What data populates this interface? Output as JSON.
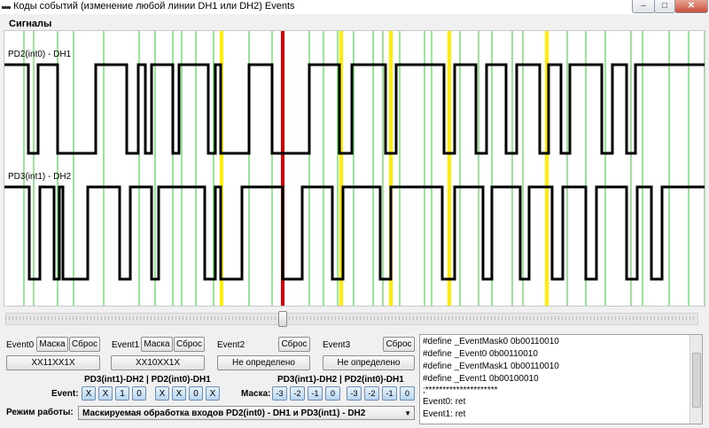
{
  "window": {
    "title": "Коды событий (изменение любой линии DH1 или DH2) Events"
  },
  "signals_panel": {
    "title": "Сигналы"
  },
  "signals": [
    {
      "label": "PD2(int0) - DH1"
    },
    {
      "label": "PD3(int1) - DH2"
    }
  ],
  "events": [
    {
      "label": "Event0",
      "mask_label": "Маска",
      "reset_label": "Сброс",
      "value": "XX11XX1X"
    },
    {
      "label": "Event1",
      "mask_label": "Маска",
      "reset_label": "Сброс",
      "value": "XX10XX1X"
    },
    {
      "label": "Event2",
      "reset_label": "Сброс",
      "value": "Не определено"
    },
    {
      "label": "Event3",
      "reset_label": "Сброс",
      "value": "Не определено"
    }
  ],
  "event_header": "PD3(int1)-DH2 | PD2(int0)-DH1",
  "event_label": "Event:",
  "event_bits": [
    "X",
    "X",
    "1",
    "0",
    "X",
    "X",
    "0",
    "X"
  ],
  "mask_header": "PD3(int1)-DH2 | PD2(int0)-DH1",
  "mask_label": "Маска:",
  "mask_bits": [
    "-3",
    "-2",
    "-1",
    "0",
    "-3",
    "-2",
    "-1",
    "0"
  ],
  "mode": {
    "label": "Режим работы:",
    "value": "Маскируемая обработка входов PD2(int0) - DH1 и PD3(int1) - DH2"
  },
  "code_lines": [
    "#define _EventMask0 0b00110010",
    "#define _Event0 0b00110010",
    "#define _EventMask1 0b00110010",
    "#define _Event1 0b00100010",
    ";*********************",
    "Event0:    ret",
    "Event1:    ret"
  ],
  "colors": {
    "signal": "#000000",
    "marker_green": "#33cc33",
    "marker_yellow": "#ffee00",
    "marker_red": "#dd0000"
  }
}
